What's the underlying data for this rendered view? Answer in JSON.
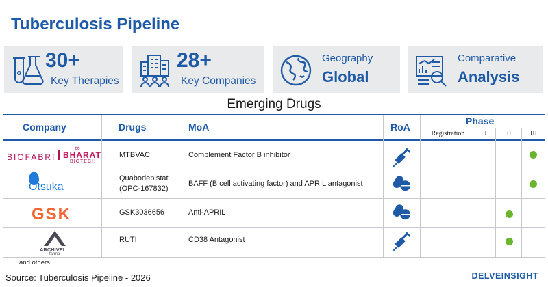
{
  "title": "Tuberculosis Pipeline",
  "stats": {
    "therapies": {
      "big": "30+",
      "small": "Key Therapies"
    },
    "companies": {
      "big": "28+",
      "small": "Key Companies"
    },
    "geography": {
      "label": "Geography",
      "value": "Global"
    },
    "comparative": {
      "label": "Comparative",
      "value": "Analysis"
    }
  },
  "section_title": "Emerging Drugs",
  "table": {
    "headers": {
      "company": "Company",
      "drugs": "Drugs",
      "moa": "MoA",
      "roa": "RoA",
      "phase": "Phase"
    },
    "phase_cols": [
      "Registration",
      "I",
      "II",
      "III"
    ],
    "rows": [
      {
        "company": "BIOFABRI | BHARAT BIOTECH",
        "company_logo_parts": [
          "BIOFABRI",
          "BHARAT",
          "BIOTECH"
        ],
        "drug": "MTBVAC",
        "moa": "Complement Factor B inhibitor",
        "roa": "injection",
        "phase": "III"
      },
      {
        "company": "Otsuka",
        "drug": "Quabodepistat (OPC-167832)",
        "drug_line1": "Quabodepistat",
        "drug_line2": "(OPC-167832)",
        "moa": "BAFF (B cell activating factor) and APRIL  antagonist",
        "roa": "oral",
        "phase": "III"
      },
      {
        "company": "GSK",
        "drug": "GSK3036656",
        "moa": "Anti-APRIL",
        "roa": "oral",
        "phase": "II"
      },
      {
        "company": "ARCHIVEL farma",
        "company_logo_parts": [
          "ARCHIVEL",
          "farma"
        ],
        "drug": "RUTI",
        "moa": "CD38 Antagonist",
        "roa": "injection",
        "phase": "II"
      }
    ]
  },
  "footnote": "and others.",
  "source": "Source: Tuberculosis Pipeline - 2026",
  "brand": "DELVEINSIGHT",
  "colors": {
    "accent": "#1f5aa6",
    "stat_bg": "#e9eaec",
    "phase_dot": "#6bb52f",
    "otsuka": "#1f7ad8",
    "gsk": "#f36633"
  }
}
